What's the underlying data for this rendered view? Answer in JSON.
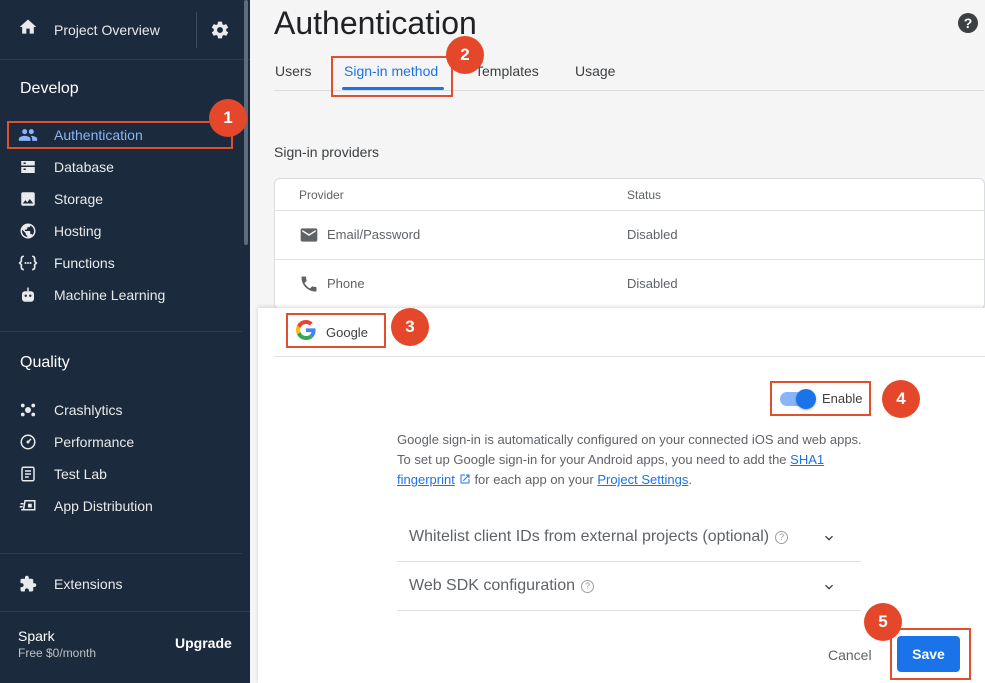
{
  "sidebar": {
    "project_overview": "Project Overview",
    "develop_title": "Develop",
    "develop_items": [
      {
        "label": "Authentication",
        "icon": "people-icon"
      },
      {
        "label": "Database",
        "icon": "database-icon"
      },
      {
        "label": "Storage",
        "icon": "image-icon"
      },
      {
        "label": "Hosting",
        "icon": "globe-icon"
      },
      {
        "label": "Functions",
        "icon": "functions-icon"
      },
      {
        "label": "Machine Learning",
        "icon": "robot-icon"
      }
    ],
    "quality_title": "Quality",
    "quality_items": [
      {
        "label": "Crashlytics",
        "icon": "crashlytics-icon"
      },
      {
        "label": "Performance",
        "icon": "speedometer-icon"
      },
      {
        "label": "Test Lab",
        "icon": "checklist-icon"
      },
      {
        "label": "App Distribution",
        "icon": "distribution-icon"
      }
    ],
    "extensions": "Extensions",
    "plan": "Spark",
    "price": "Free $0/month",
    "upgrade": "Upgrade"
  },
  "main": {
    "title": "Authentication",
    "tabs": [
      "Users",
      "Sign-in method",
      "Templates",
      "Usage"
    ],
    "active_tab": "Sign-in method",
    "providers_title": "Sign-in providers",
    "columns": [
      "Provider",
      "Status"
    ],
    "providers": [
      {
        "name": "Email/Password",
        "status": "Disabled",
        "icon": "mail-icon"
      },
      {
        "name": "Phone",
        "status": "Disabled",
        "icon": "phone-icon"
      }
    ]
  },
  "google_panel": {
    "name": "Google",
    "toggle_label": "Enable",
    "enabled": true,
    "desc_part1": "Google sign-in is automatically configured on your connected iOS and web apps. To set up Google sign-in for your Android apps, you need to add the",
    "sha1_link": "SHA1 fingerprint",
    "desc_part2": "for each app on your",
    "settings_link": "Project Settings",
    "desc_part3": ".",
    "expanders": [
      "Whitelist client IDs from external projects (optional)",
      "Web SDK configuration"
    ],
    "cancel": "Cancel",
    "save": "Save"
  },
  "annotations": [
    "1",
    "2",
    "3",
    "4",
    "5"
  ],
  "colors": {
    "sidebar_bg": "#1b2a3c",
    "accent": "#1a73e8",
    "highlight": "#e0502f"
  }
}
